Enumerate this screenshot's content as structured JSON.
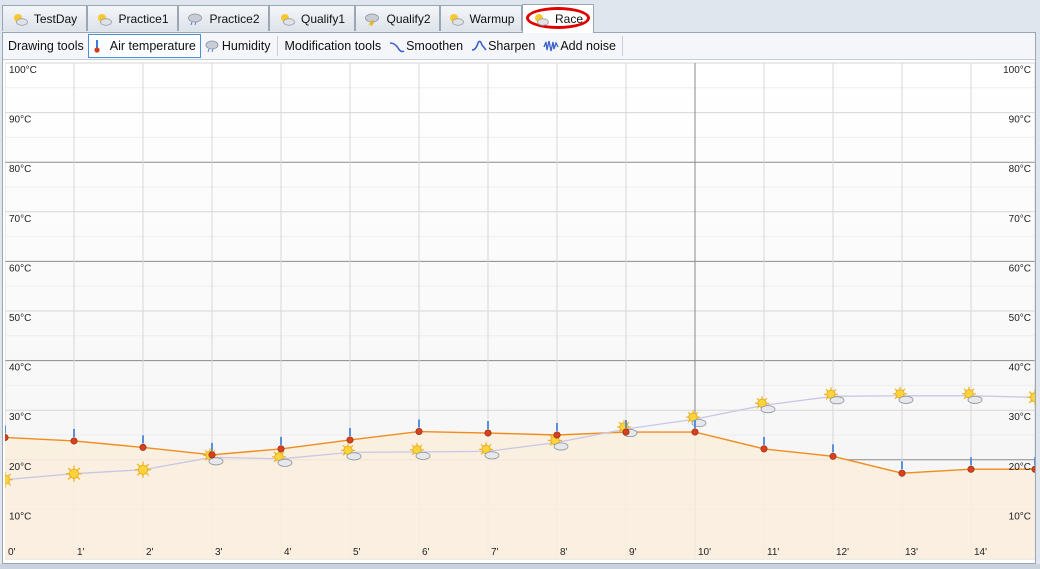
{
  "tabs": [
    {
      "label": "TestDay",
      "icon": "sun-cloud-icon"
    },
    {
      "label": "Practice1",
      "icon": "sun-cloud-icon"
    },
    {
      "label": "Practice2",
      "icon": "rain-cloud-icon"
    },
    {
      "label": "Qualify1",
      "icon": "sun-cloud-icon"
    },
    {
      "label": "Qualify2",
      "icon": "storm-cloud-icon"
    },
    {
      "label": "Warmup",
      "icon": "sun-cloud-icon"
    },
    {
      "label": "Race",
      "icon": "sun-cloud-icon",
      "active": true
    }
  ],
  "toolbar": {
    "drawing_label": "Drawing tools",
    "air_temperature": "Air temperature",
    "humidity": "Humidity",
    "modification_label": "Modification tools",
    "smoothen": "Smoothen",
    "sharpen": "Sharpen",
    "add_noise": "Add noise"
  },
  "colors": {
    "air_line": "#f08c1c",
    "air_fill": "#fbeede",
    "humidity_line": "#c8c8e6",
    "grid": "#d7d7d7",
    "grid_major": "#8a8a8a"
  },
  "chart_data": {
    "type": "line",
    "x": [
      "0'",
      "1'",
      "2'",
      "3'",
      "4'",
      "5'",
      "6'",
      "7'",
      "8'",
      "9'",
      "10'",
      "11'",
      "12'",
      "13'",
      "14'"
    ],
    "yticks": [
      "10°C",
      "20°C",
      "30°C",
      "40°C",
      "50°C",
      "60°C",
      "70°C",
      "80°C",
      "90°C",
      "100°C"
    ],
    "ylim": [
      0,
      100
    ],
    "series": [
      {
        "key": "air",
        "values": [
          24.5,
          23.8,
          22.5,
          21,
          22.2,
          24,
          25.7,
          25.4,
          25,
          25.6,
          25.6,
          22.2,
          20.7,
          17.3,
          18.1,
          18.1
        ]
      },
      {
        "key": "humidity",
        "values": [
          16,
          17.2,
          18,
          20.5,
          20.2,
          21.5,
          21.6,
          21.7,
          23.5,
          26.2,
          28.2,
          31,
          32.8,
          32.9,
          32.9,
          32.6
        ]
      }
    ],
    "humidity_icons": [
      "sun",
      "sun",
      "sun",
      "sun-cloud",
      "sun-cloud",
      "sun-cloud",
      "sun-cloud",
      "sun-cloud",
      "sun-cloud",
      "sun-cloud",
      "sun-cloud",
      "sun-cloud",
      "sun-cloud",
      "sun-cloud",
      "sun-cloud",
      "sun"
    ]
  }
}
